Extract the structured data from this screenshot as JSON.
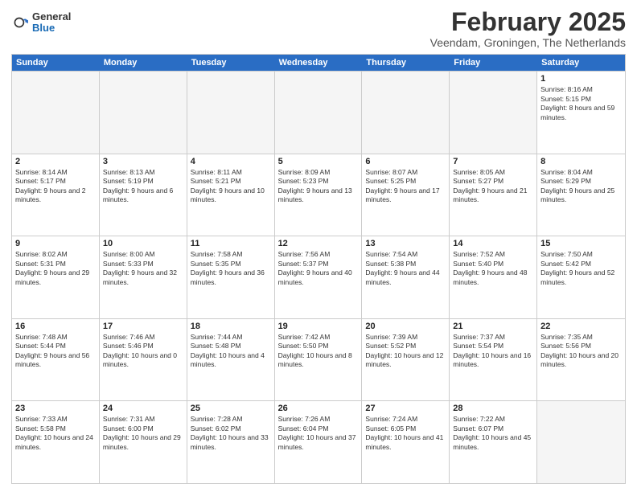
{
  "logo": {
    "general": "General",
    "blue": "Blue"
  },
  "title": "February 2025",
  "subtitle": "Veendam, Groningen, The Netherlands",
  "header_days": [
    "Sunday",
    "Monday",
    "Tuesday",
    "Wednesday",
    "Thursday",
    "Friday",
    "Saturday"
  ],
  "weeks": [
    [
      {
        "day": "",
        "info": ""
      },
      {
        "day": "",
        "info": ""
      },
      {
        "day": "",
        "info": ""
      },
      {
        "day": "",
        "info": ""
      },
      {
        "day": "",
        "info": ""
      },
      {
        "day": "",
        "info": ""
      },
      {
        "day": "1",
        "info": "Sunrise: 8:16 AM\nSunset: 5:15 PM\nDaylight: 8 hours and 59 minutes."
      }
    ],
    [
      {
        "day": "2",
        "info": "Sunrise: 8:14 AM\nSunset: 5:17 PM\nDaylight: 9 hours and 2 minutes."
      },
      {
        "day": "3",
        "info": "Sunrise: 8:13 AM\nSunset: 5:19 PM\nDaylight: 9 hours and 6 minutes."
      },
      {
        "day": "4",
        "info": "Sunrise: 8:11 AM\nSunset: 5:21 PM\nDaylight: 9 hours and 10 minutes."
      },
      {
        "day": "5",
        "info": "Sunrise: 8:09 AM\nSunset: 5:23 PM\nDaylight: 9 hours and 13 minutes."
      },
      {
        "day": "6",
        "info": "Sunrise: 8:07 AM\nSunset: 5:25 PM\nDaylight: 9 hours and 17 minutes."
      },
      {
        "day": "7",
        "info": "Sunrise: 8:05 AM\nSunset: 5:27 PM\nDaylight: 9 hours and 21 minutes."
      },
      {
        "day": "8",
        "info": "Sunrise: 8:04 AM\nSunset: 5:29 PM\nDaylight: 9 hours and 25 minutes."
      }
    ],
    [
      {
        "day": "9",
        "info": "Sunrise: 8:02 AM\nSunset: 5:31 PM\nDaylight: 9 hours and 29 minutes."
      },
      {
        "day": "10",
        "info": "Sunrise: 8:00 AM\nSunset: 5:33 PM\nDaylight: 9 hours and 32 minutes."
      },
      {
        "day": "11",
        "info": "Sunrise: 7:58 AM\nSunset: 5:35 PM\nDaylight: 9 hours and 36 minutes."
      },
      {
        "day": "12",
        "info": "Sunrise: 7:56 AM\nSunset: 5:37 PM\nDaylight: 9 hours and 40 minutes."
      },
      {
        "day": "13",
        "info": "Sunrise: 7:54 AM\nSunset: 5:38 PM\nDaylight: 9 hours and 44 minutes."
      },
      {
        "day": "14",
        "info": "Sunrise: 7:52 AM\nSunset: 5:40 PM\nDaylight: 9 hours and 48 minutes."
      },
      {
        "day": "15",
        "info": "Sunrise: 7:50 AM\nSunset: 5:42 PM\nDaylight: 9 hours and 52 minutes."
      }
    ],
    [
      {
        "day": "16",
        "info": "Sunrise: 7:48 AM\nSunset: 5:44 PM\nDaylight: 9 hours and 56 minutes."
      },
      {
        "day": "17",
        "info": "Sunrise: 7:46 AM\nSunset: 5:46 PM\nDaylight: 10 hours and 0 minutes."
      },
      {
        "day": "18",
        "info": "Sunrise: 7:44 AM\nSunset: 5:48 PM\nDaylight: 10 hours and 4 minutes."
      },
      {
        "day": "19",
        "info": "Sunrise: 7:42 AM\nSunset: 5:50 PM\nDaylight: 10 hours and 8 minutes."
      },
      {
        "day": "20",
        "info": "Sunrise: 7:39 AM\nSunset: 5:52 PM\nDaylight: 10 hours and 12 minutes."
      },
      {
        "day": "21",
        "info": "Sunrise: 7:37 AM\nSunset: 5:54 PM\nDaylight: 10 hours and 16 minutes."
      },
      {
        "day": "22",
        "info": "Sunrise: 7:35 AM\nSunset: 5:56 PM\nDaylight: 10 hours and 20 minutes."
      }
    ],
    [
      {
        "day": "23",
        "info": "Sunrise: 7:33 AM\nSunset: 5:58 PM\nDaylight: 10 hours and 24 minutes."
      },
      {
        "day": "24",
        "info": "Sunrise: 7:31 AM\nSunset: 6:00 PM\nDaylight: 10 hours and 29 minutes."
      },
      {
        "day": "25",
        "info": "Sunrise: 7:28 AM\nSunset: 6:02 PM\nDaylight: 10 hours and 33 minutes."
      },
      {
        "day": "26",
        "info": "Sunrise: 7:26 AM\nSunset: 6:04 PM\nDaylight: 10 hours and 37 minutes."
      },
      {
        "day": "27",
        "info": "Sunrise: 7:24 AM\nSunset: 6:05 PM\nDaylight: 10 hours and 41 minutes."
      },
      {
        "day": "28",
        "info": "Sunrise: 7:22 AM\nSunset: 6:07 PM\nDaylight: 10 hours and 45 minutes."
      },
      {
        "day": "",
        "info": ""
      }
    ]
  ]
}
